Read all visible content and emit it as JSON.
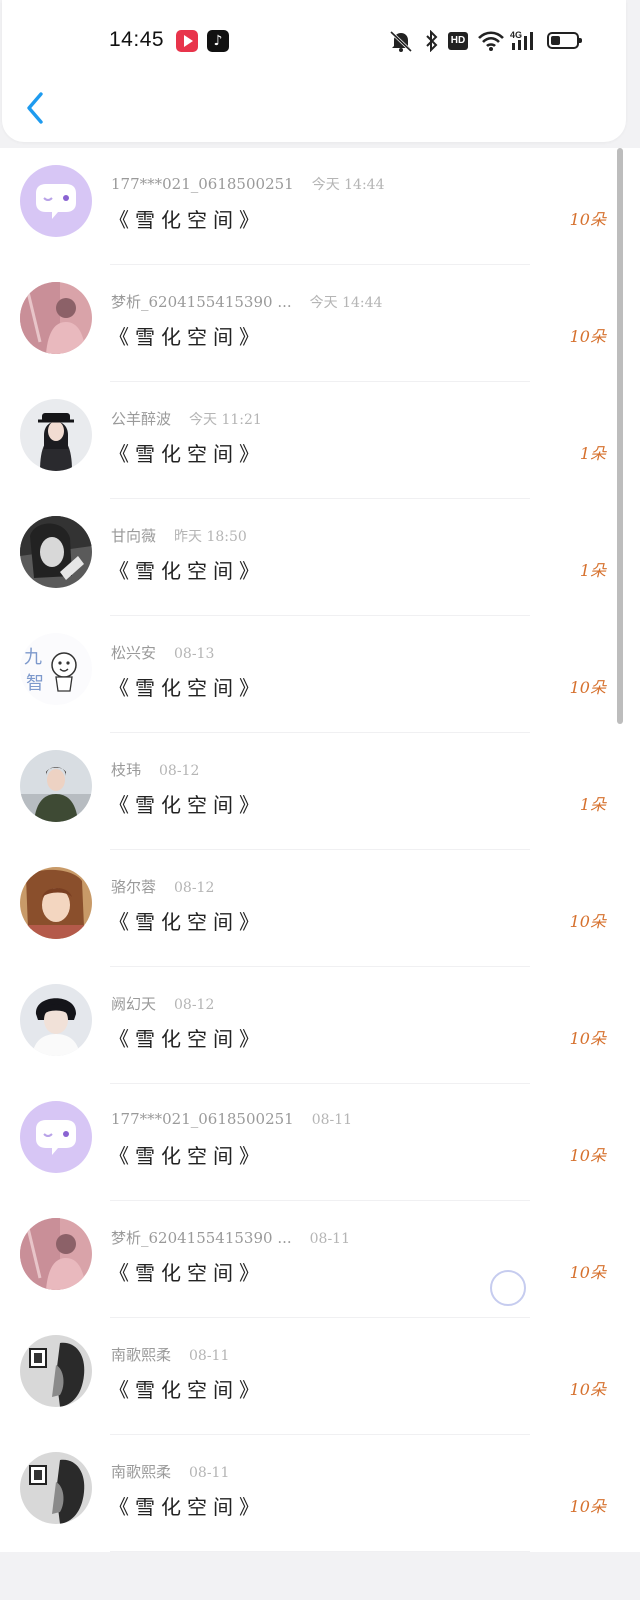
{
  "status_bar": {
    "time": "14:45",
    "icons": [
      "video-app-icon",
      "tiktok-icon",
      "mute-bell-icon",
      "bluetooth-icon",
      "hd-icon",
      "wifi-icon",
      "signal-4g-icon",
      "battery-icon"
    ],
    "hd_label": "HD",
    "signal_label": "4G",
    "battery_level": 0.35
  },
  "header": {
    "back_icon": "chevron-left-icon",
    "accent": "#1e9bef"
  },
  "colors": {
    "count": "#d6712e",
    "name": "#9a9a9a",
    "loader": "#c6ccef"
  },
  "items": [
    {
      "name": "177***021_0618500251",
      "time": "今天 14:44",
      "book": "《雪化空间》",
      "count": "10朵",
      "avatar": "chat-bubble"
    },
    {
      "name": "梦析_6204155415390 ...",
      "time": "今天 14:44",
      "book": "《雪化空间》",
      "count": "10朵",
      "avatar": "photo-pink"
    },
    {
      "name": "公羊醉波",
      "time": "今天 11:21",
      "book": "《雪化空间》",
      "count": "1朵",
      "avatar": "photo-girl-cap"
    },
    {
      "name": "甘向薇",
      "time": "昨天 18:50",
      "book": "《雪化空间》",
      "count": "1朵",
      "avatar": "photo-bw-girl"
    },
    {
      "name": "松兴安",
      "time": "08-13",
      "book": "《雪化空间》",
      "count": "10朵",
      "avatar": "cartoon"
    },
    {
      "name": "枝玮",
      "time": "08-12",
      "book": "《雪化空间》",
      "count": "1朵",
      "avatar": "photo-green-coat"
    },
    {
      "name": "骆尔蓉",
      "time": "08-12",
      "book": "《雪化空间》",
      "count": "10朵",
      "avatar": "photo-warm"
    },
    {
      "name": "阙幻天",
      "time": "08-12",
      "book": "《雪化空间》",
      "count": "10朵",
      "avatar": "photo-boy"
    },
    {
      "name": "177***021_0618500251",
      "time": "08-11",
      "book": "《雪化空间》",
      "count": "10朵",
      "avatar": "chat-bubble"
    },
    {
      "name": "梦析_6204155415390 ...",
      "time": "08-11",
      "book": "《雪化空间》",
      "count": "10朵",
      "avatar": "photo-pink"
    },
    {
      "name": "南歌熙柔",
      "time": "08-11",
      "book": "《雪化空间》",
      "count": "10朵",
      "avatar": "photo-bw-room"
    },
    {
      "name": "南歌熙柔",
      "time": "08-11",
      "book": "《雪化空间》",
      "count": "10朵",
      "avatar": "photo-bw-room"
    }
  ]
}
